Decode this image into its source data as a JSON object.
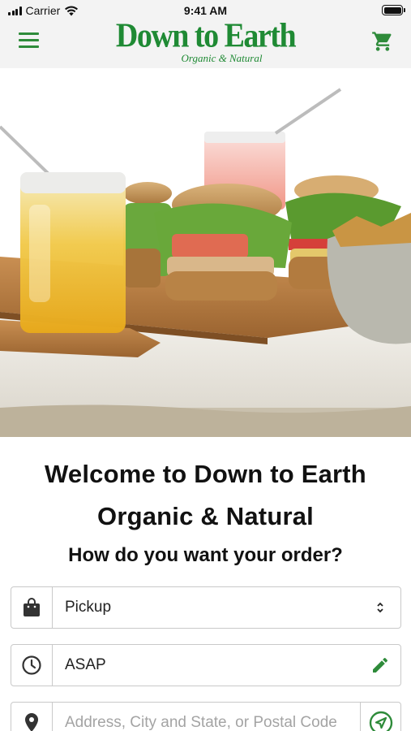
{
  "status_bar": {
    "carrier": "Carrier",
    "time": "9:41 AM"
  },
  "header": {
    "logo_main": "Down to Earth",
    "logo_sub": "Organic & Natural",
    "icons": {
      "menu": "hamburger-menu-icon",
      "cart": "shopping-cart-icon"
    }
  },
  "welcome": {
    "line1": "Welcome to Down to Earth",
    "line2": "Organic & Natural"
  },
  "order": {
    "question": "How do you want your order?",
    "method": {
      "value": "Pickup",
      "icon": "shopping-bag-icon",
      "control": "select-arrows-icon"
    },
    "time": {
      "value": "ASAP",
      "icon": "clock-icon",
      "action": "pencil-edit-icon"
    },
    "address": {
      "placeholder": "Address, City and State, or Postal Code",
      "icon": "location-pin-icon",
      "action": "navigation-arrow-icon"
    }
  },
  "colors": {
    "brand_green": "#1f8a34",
    "header_bg": "#f3f3f3",
    "field_border": "#c9c9c9"
  }
}
